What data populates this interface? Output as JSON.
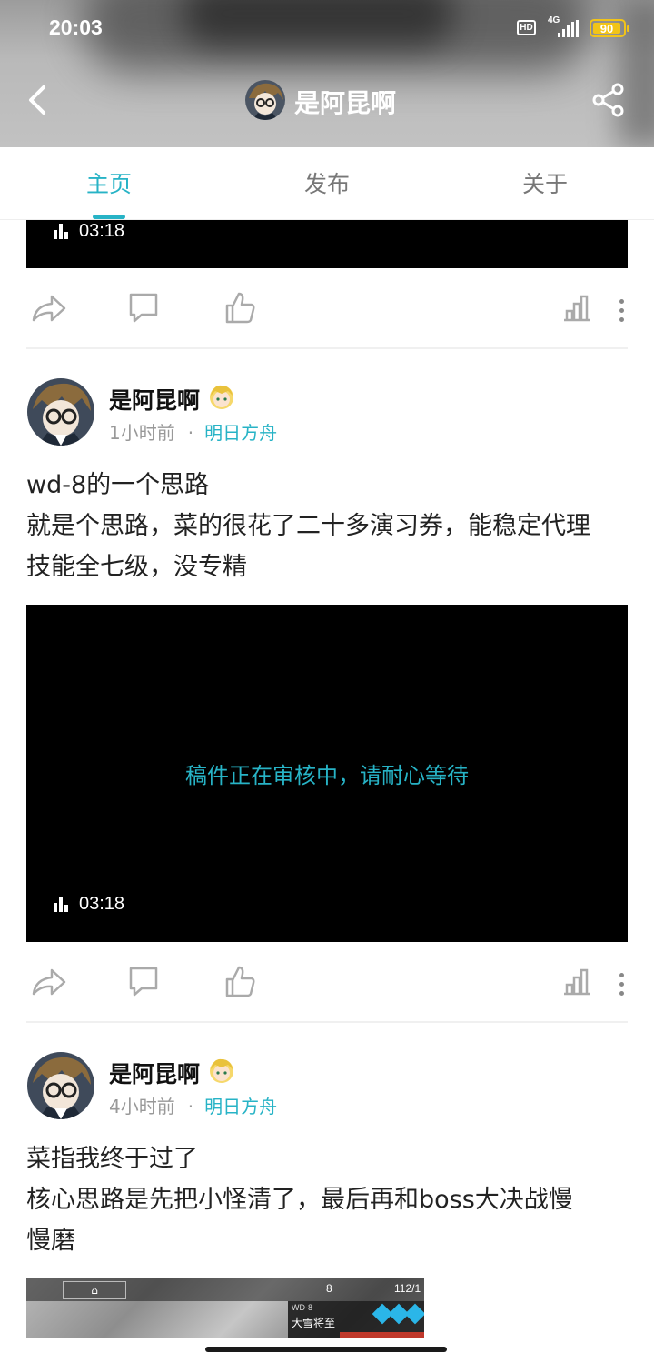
{
  "status_bar": {
    "time": "20:03",
    "hd": "HD",
    "network": "4G",
    "battery": "90"
  },
  "header": {
    "title": "是阿昆啊"
  },
  "tabs": [
    {
      "label": "主页",
      "active": true
    },
    {
      "label": "发布",
      "active": false
    },
    {
      "label": "关于",
      "active": false
    }
  ],
  "top_video": {
    "duration": "03:18"
  },
  "posts": [
    {
      "author": "是阿昆啊",
      "time_ago": "1小时前",
      "separator": "·",
      "topic": "明日方舟",
      "text_lines": [
        "wd-8的一个思路",
        "就是个思路，菜的很花了二十多演习券，能稳定代理",
        "技能全七级，没专精"
      ],
      "video": {
        "review_message": "稿件正在审核中，请耐心等待",
        "duration": "03:18"
      }
    },
    {
      "author": "是阿昆啊",
      "time_ago": "4小时前",
      "separator": "·",
      "topic": "明日方舟",
      "text_lines": [
        "菜指我终于过了",
        "核心思路是先把小怪清了，最后再和boss大决战慢",
        "慢磨"
      ],
      "image": {
        "stage_code": "WD-8",
        "stage_name": "大雪将至",
        "top_value_left": "8",
        "top_value_right": "112/1"
      }
    }
  ],
  "colors": {
    "accent": "#27b3c6",
    "battery": "#f2c418",
    "icon_gray": "#999999"
  },
  "icons": [
    "back-arrow",
    "share",
    "forward-arrow",
    "comment-bubble",
    "thumbs-up",
    "stats-chart",
    "more-vertical"
  ]
}
